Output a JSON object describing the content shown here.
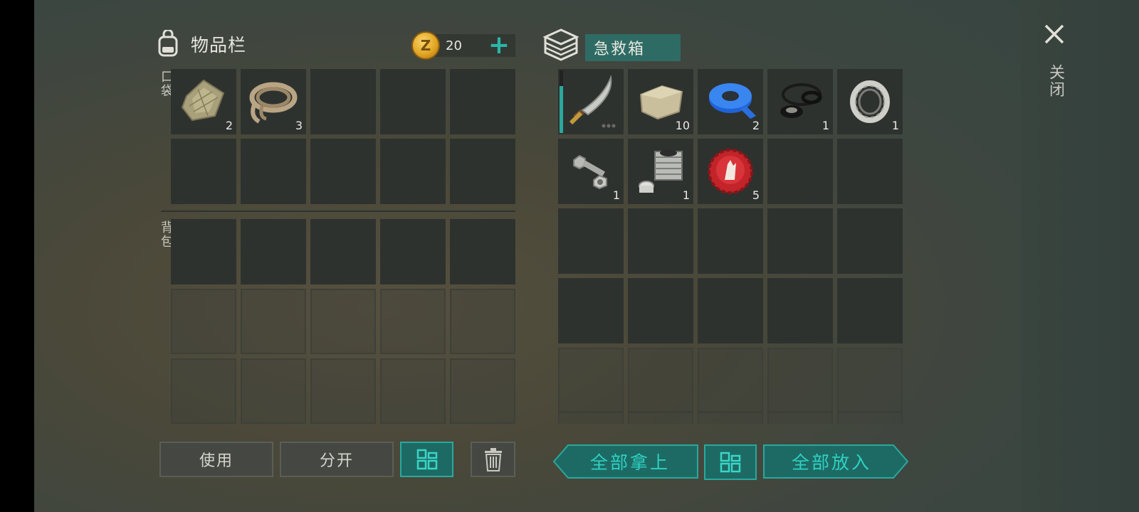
{
  "inventory": {
    "title": "物品栏",
    "coins": "20",
    "pocket_label": "口袋",
    "backpack_label": "背包",
    "pocket_items": [
      {
        "name": "cloth",
        "qty": "2"
      },
      {
        "name": "rope",
        "qty": "3"
      }
    ]
  },
  "chest": {
    "title": "急救箱",
    "items": [
      {
        "name": "machete",
        "qty": ""
      },
      {
        "name": "stone",
        "qty": "10"
      },
      {
        "name": "blue-tape",
        "qty": "2"
      },
      {
        "name": "rubber-seals",
        "qty": "1"
      },
      {
        "name": "bearing",
        "qty": "1"
      },
      {
        "name": "bolt-nut",
        "qty": "1"
      },
      {
        "name": "engine-cylinder",
        "qty": "1"
      },
      {
        "name": "bottle-cap",
        "qty": "5"
      }
    ]
  },
  "buttons": {
    "use": "使用",
    "split": "分开",
    "take_all": "全部拿上",
    "put_all": "全部放入"
  },
  "close_label": "关闭",
  "colors": {
    "accent": "#2fd1c1",
    "teal_bg": "#1d6a64",
    "slot": "#2e322f"
  }
}
